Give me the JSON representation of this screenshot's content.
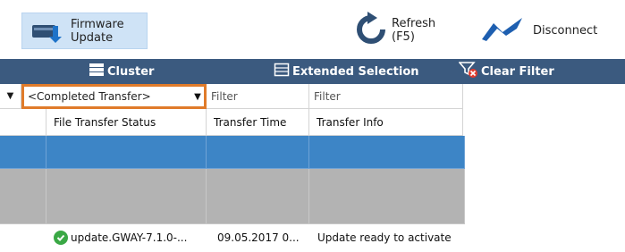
{
  "toolbar": {
    "firmware_update_label_line1": "Firmware",
    "firmware_update_label_line2": "Update",
    "refresh_label_line1": "Refresh",
    "refresh_label_line2": "(F5)",
    "disconnect_label": "Disconnect"
  },
  "bluebar": {
    "cluster_label": "Cluster",
    "extended_selection_label": "Extended Selection",
    "clear_filter_label": "Clear Filter"
  },
  "filters": {
    "status_combo_value": "<Completed Transfer>",
    "transfer_time_placeholder": "Filter",
    "transfer_info_placeholder": "Filter"
  },
  "columns": [
    "File Transfer Status",
    "Transfer Time",
    "Transfer Info"
  ],
  "rows": [
    {
      "status": "update.GWAY-7.1.0-...",
      "time": "09.05.2017 0...",
      "info": "Update ready to activate"
    }
  ],
  "colors": {
    "bluebar": "#3b5a7f",
    "selected_row": "#3d85c6",
    "highlight_border": "#e07b2a",
    "success": "#3aa845"
  }
}
